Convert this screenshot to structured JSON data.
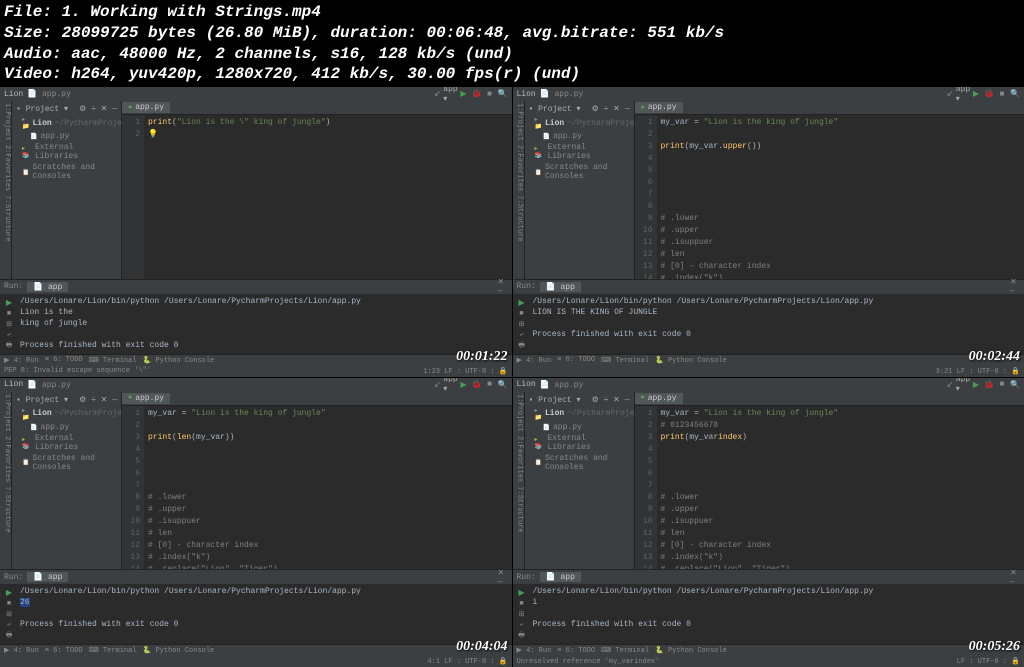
{
  "header": {
    "file": "File: 1. Working with Strings.mp4",
    "size": "Size: 28099725 bytes (26.80 MiB), duration: 00:06:48, avg.bitrate: 551 kb/s",
    "audio": "Audio: aac, 48000 Hz, 2 channels, s16, 128 kb/s (und)",
    "video": "Video: h264, yuv420p, 1280x720, 412 kb/s, 30.00 fps(r) (und)"
  },
  "common": {
    "window_title": "Lion",
    "tab_name": "app.py",
    "project_label": "Project",
    "project_name": "Lion",
    "project_path": "~/PycharmProjects/Lion",
    "app_file": "app.py",
    "ext_libs": "External Libraries",
    "scratches": "Scratches and Consoles",
    "run_label": "Run:",
    "run_tab": "app",
    "cmd_line": "/Users/Lonare/Lion/bin/python /Users/Lonare/PycharmProjects/Lion/app.py",
    "exit_msg": "Process finished with exit code 0",
    "bt_run": "▶ 4: Run",
    "bt_todo": "≡ 6: TODO",
    "bt_term": "⌨ Terminal",
    "bt_pycon": "🐍 Python Console",
    "status_right": "LF : UTF-8 :"
  },
  "panes": [
    {
      "timestamp": "00:01:22",
      "lines": [
        "1",
        "2"
      ],
      "code": [
        {
          "t": "print",
          "c": "fn"
        },
        {
          "t": "(",
          "c": ""
        },
        {
          "t": "\"Lion is the \\\" king of jungle\"",
          "c": "str"
        },
        {
          "t": ")",
          "c": ""
        }
      ],
      "code2": "💡",
      "output": [
        "Lion is the",
        "king of jungle"
      ],
      "status_left": "PEP 8: Invalid escape sequence '\\\"'",
      "status_pos": "1:23"
    },
    {
      "timestamp": "00:02:44",
      "lines": [
        "1",
        "2",
        "3",
        "4",
        "5",
        "6",
        "7",
        "8",
        "9",
        "10",
        "11",
        "12",
        "13",
        "14"
      ],
      "codelines": [
        "my_var = |\"Lion is the king of jungle\"",
        "",
        "|print|(|my_var.|upper|()|)",
        "",
        "",
        "",
        "",
        "",
        "|# .lower",
        "|# .upper",
        "|# .isuppuer",
        "|# len",
        "|# [0] - character index",
        "|# .index(\"k\")"
      ],
      "output": [
        "LION IS THE KING OF JUNGLE"
      ],
      "status_pos": "3:21"
    },
    {
      "timestamp": "00:04:04",
      "lines": [
        "1",
        "2",
        "3",
        "4",
        "5",
        "6",
        "7",
        "8",
        "9",
        "10",
        "11",
        "12",
        "13",
        "14"
      ],
      "codelines": [
        "my_var = |\"Lion is the king of jungle\"",
        "",
        "|print|(|len|(my_var)|)",
        "",
        "",
        "",
        "",
        "|# .lower",
        "|# .upper",
        "|# .isuppuer",
        "|# len",
        "|# [0] - character index",
        "|# .index(\"k\")",
        "|# .replace(\"Lion\", \"Tiger\")"
      ],
      "output": [
        "26"
      ],
      "output_hl": true,
      "status_pos": "4:1"
    },
    {
      "timestamp": "00:05:26",
      "lines": [
        "1",
        "2",
        "3",
        "4",
        "5",
        "6",
        "7",
        "8",
        "9",
        "10",
        "11",
        "12",
        "13",
        "14"
      ],
      "codelines": [
        "my_var = |\"Lion is the king of jungle\"",
        "|#         0123456678",
        "|print|(|my_var|index|)",
        "",
        "",
        "",
        "",
        "|# .lower",
        "|# .upper",
        "|# .isuppuer",
        "|# len",
        "|# [0] - character index",
        "|# .index(\"k\")",
        "|# .replace(\"Lion\", \"Tiger\")"
      ],
      "output": [
        "i"
      ],
      "status_left": "Unresolved reference 'my_varindex'",
      "status_pos": ""
    }
  ]
}
